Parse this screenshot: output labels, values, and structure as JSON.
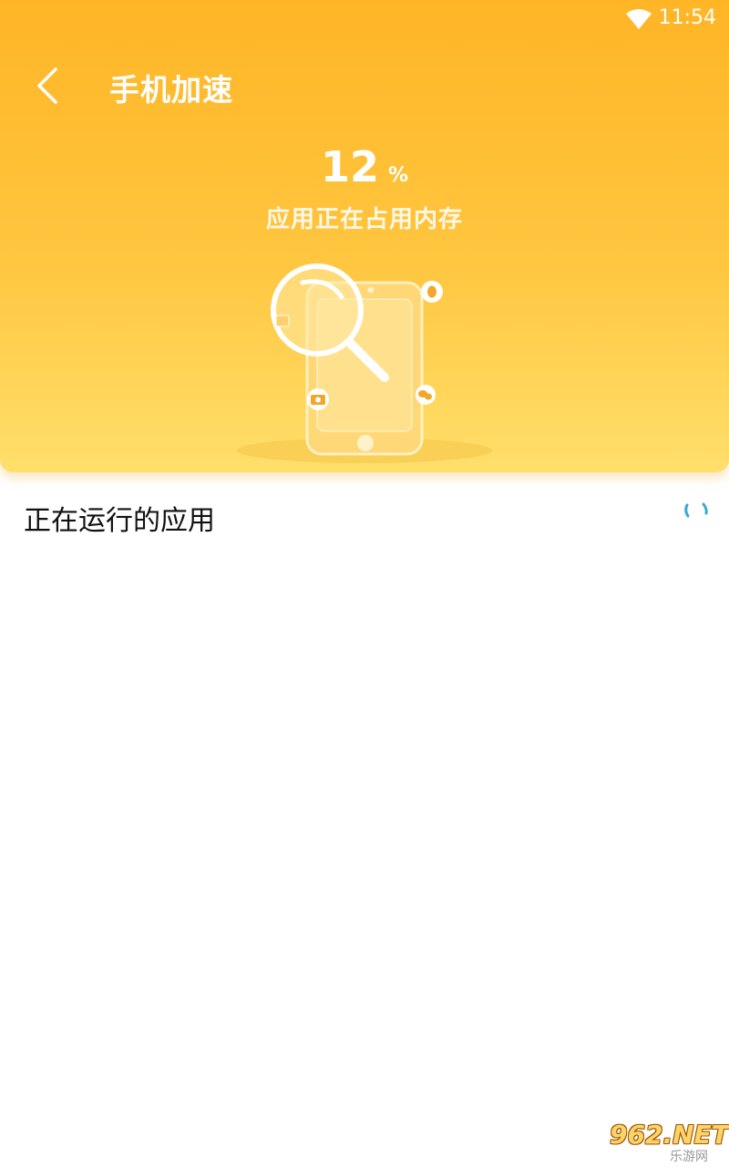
{
  "status_bar": {
    "time": "11:54",
    "wifi_icon": "wifi-icon"
  },
  "header": {
    "back_icon": "chevron-left-icon",
    "title": "手机加速",
    "memory_percent": "12",
    "percent_symbol": "%",
    "subtitle": "应用正在占用内存",
    "gradient_colors": [
      "#ffb526",
      "#ffdf6b"
    ]
  },
  "main": {
    "section_title": "正在运行的应用",
    "loader_icon": "loading-spinner-icon",
    "loader_color": "#3aa8d6"
  },
  "watermark": {
    "main": "962.NET",
    "sub": "乐游网"
  }
}
